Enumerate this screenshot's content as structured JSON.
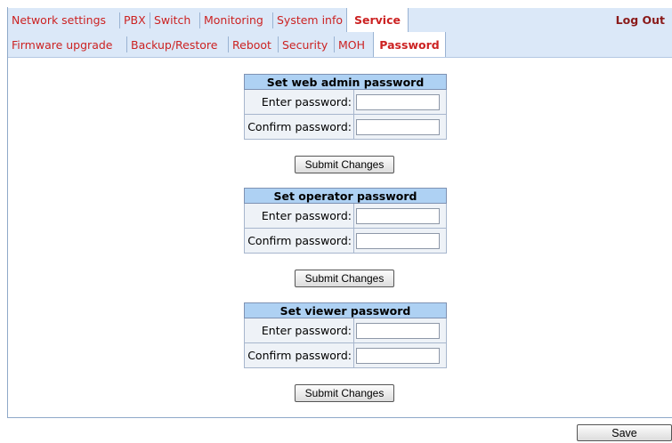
{
  "top_tabs": [
    {
      "label": "Network settings",
      "active": false
    },
    {
      "label": "PBX",
      "active": false
    },
    {
      "label": "Switch",
      "active": false
    },
    {
      "label": "Monitoring",
      "active": false
    },
    {
      "label": "System info",
      "active": false
    },
    {
      "label": "Service",
      "active": true
    }
  ],
  "logout_label": "Log Out",
  "sub_tabs": [
    {
      "label": "Firmware upgrade",
      "active": false
    },
    {
      "label": "Backup/Restore",
      "active": false
    },
    {
      "label": "Reboot",
      "active": false
    },
    {
      "label": "Security",
      "active": false
    },
    {
      "label": "MOH",
      "active": false
    },
    {
      "label": "Password",
      "active": true
    }
  ],
  "sections": [
    {
      "title": "Set web admin password",
      "enter_label": "Enter password:",
      "confirm_label": "Confirm password:",
      "enter_value": "",
      "confirm_value": "",
      "submit_label": "Submit Changes"
    },
    {
      "title": "Set operator password",
      "enter_label": "Enter password:",
      "confirm_label": "Confirm password:",
      "enter_value": "",
      "confirm_value": "",
      "submit_label": "Submit Changes"
    },
    {
      "title": "Set viewer password",
      "enter_label": "Enter password:",
      "confirm_label": "Confirm password:",
      "enter_value": "",
      "confirm_value": "",
      "submit_label": "Submit Changes"
    }
  ],
  "save_label": "Save",
  "colors": {
    "tab_text": "#cc2222",
    "tab_bar": "#dbe8f8",
    "section_header": "#aed1f3",
    "logout": "#8a1a1a"
  }
}
